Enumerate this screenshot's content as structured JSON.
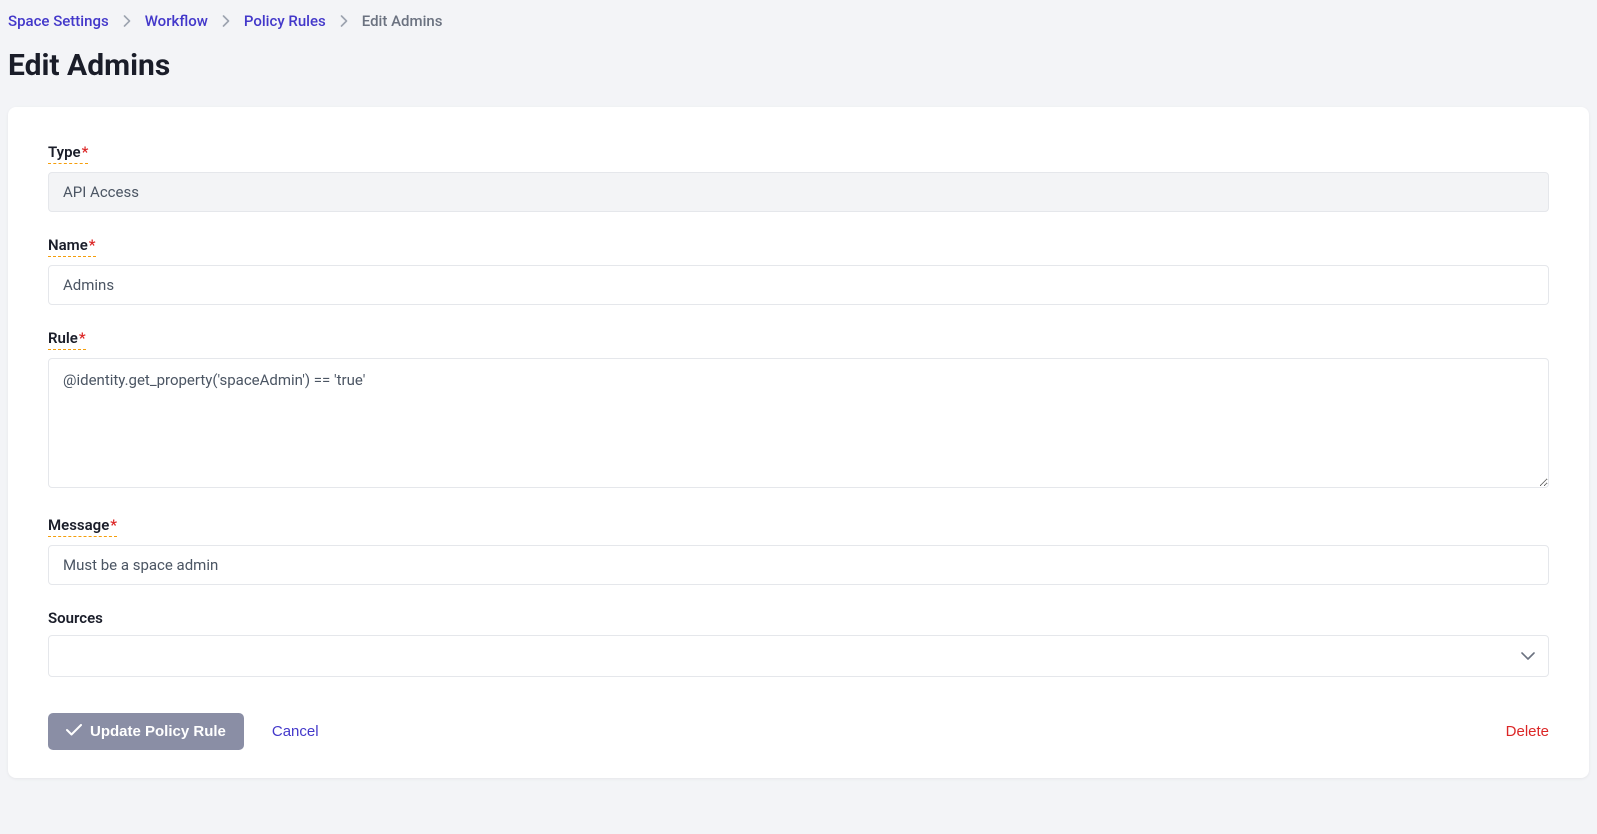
{
  "breadcrumb": {
    "items": [
      {
        "label": "Space Settings"
      },
      {
        "label": "Workflow"
      },
      {
        "label": "Policy Rules"
      }
    ],
    "current": "Edit Admins"
  },
  "pageTitle": "Edit Admins",
  "form": {
    "typeLabel": "Type",
    "typeValue": "API Access",
    "nameLabel": "Name",
    "nameValue": "Admins",
    "ruleLabel": "Rule",
    "ruleValue": "@identity.get_property('spaceAdmin') == 'true'",
    "messageLabel": "Message",
    "messageValue": "Must be a space admin",
    "sourcesLabel": "Sources",
    "sourcesValue": ""
  },
  "buttons": {
    "update": "Update Policy Rule",
    "cancel": "Cancel",
    "delete": "Delete"
  },
  "requiredMark": "*"
}
